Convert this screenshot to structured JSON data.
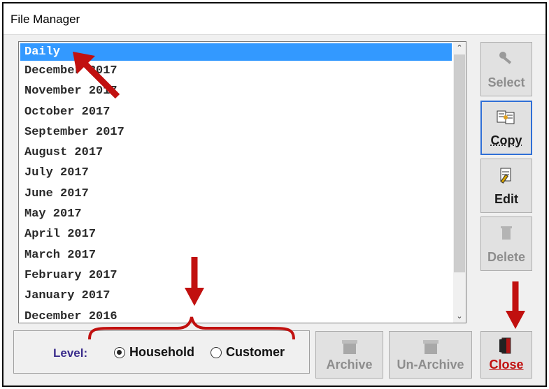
{
  "window": {
    "title": "File Manager"
  },
  "list": {
    "items": [
      "Daily",
      "December 2017",
      "November 2017",
      "October 2017",
      "September 2017",
      "August 2017",
      "July 2017",
      "June 2017",
      "May 2017",
      "April 2017",
      "March 2017",
      "February 2017",
      "January 2017",
      "December 2016"
    ],
    "selected_index": 0
  },
  "buttons": {
    "select": "Select",
    "copy": "Copy",
    "edit": "Edit",
    "delete": "Delete",
    "archive": "Archive",
    "unarchive": "Un-Archive",
    "close": "Close"
  },
  "level": {
    "label": "Level:",
    "options": [
      "Household",
      "Customer"
    ],
    "selected": "Household"
  },
  "colors": {
    "selection": "#3399ff",
    "annotation": "#c1100f",
    "level_label": "#3b2d8c"
  },
  "icons": {
    "select": "key-icon",
    "copy": "copy-icon",
    "edit": "edit-icon",
    "delete": "trash-icon",
    "archive": "archive-box-icon",
    "unarchive": "unarchive-box-icon",
    "close": "exit-door-icon"
  }
}
